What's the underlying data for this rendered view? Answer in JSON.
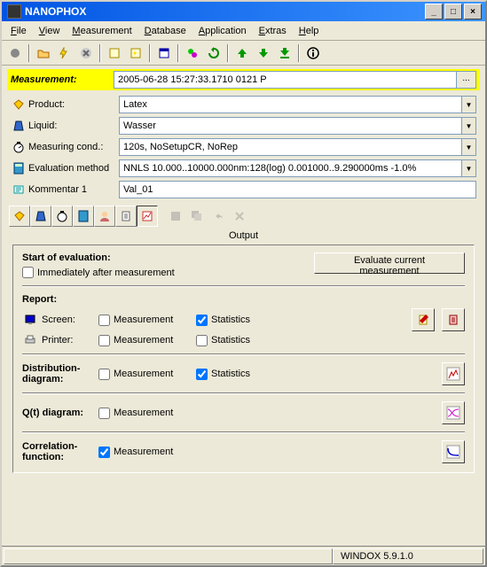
{
  "window": {
    "title": "NANOPHOX"
  },
  "menu": {
    "file": "File",
    "view": "View",
    "measurement": "Measurement",
    "database": "Database",
    "application": "Application",
    "extras": "Extras",
    "help": "Help"
  },
  "highlight": {
    "label": "Measurement:",
    "value": "2005-06-28 15:27:33.1710 0121 P",
    "btn": "..."
  },
  "params": {
    "product": {
      "label": "Product:",
      "value": "Latex"
    },
    "liquid": {
      "label": "Liquid:",
      "value": "Wasser"
    },
    "cond": {
      "label": "Measuring cond.:",
      "value": "120s, NoSetupCR, NoRep"
    },
    "eval": {
      "label": "Evaluation method",
      "value": "NNLS 10.000..10000.000nm:128(log) 0.001000..9.290000ms -1.0%"
    },
    "comment": {
      "label": "Kommentar 1",
      "value": "Val_01"
    }
  },
  "output": {
    "title": "Output",
    "start": {
      "label": "Start of evaluation:",
      "chk": "Immediately after measurement",
      "btn": "Evaluate current measurement"
    },
    "report": {
      "label": "Report:",
      "screen": "Screen:",
      "printer": "Printer:",
      "meas": "Measurement",
      "stats": "Statistics"
    },
    "dist": {
      "label1": "Distribution-",
      "label2": "diagram:",
      "meas": "Measurement",
      "stats": "Statistics"
    },
    "qt": {
      "label": "Q(t) diagram:",
      "meas": "Measurement"
    },
    "corr": {
      "label1": "Correlation-",
      "label2": "function:",
      "meas": "Measurement"
    }
  },
  "statusbar": {
    "windox": "WINDOX 5.9.1.0"
  }
}
